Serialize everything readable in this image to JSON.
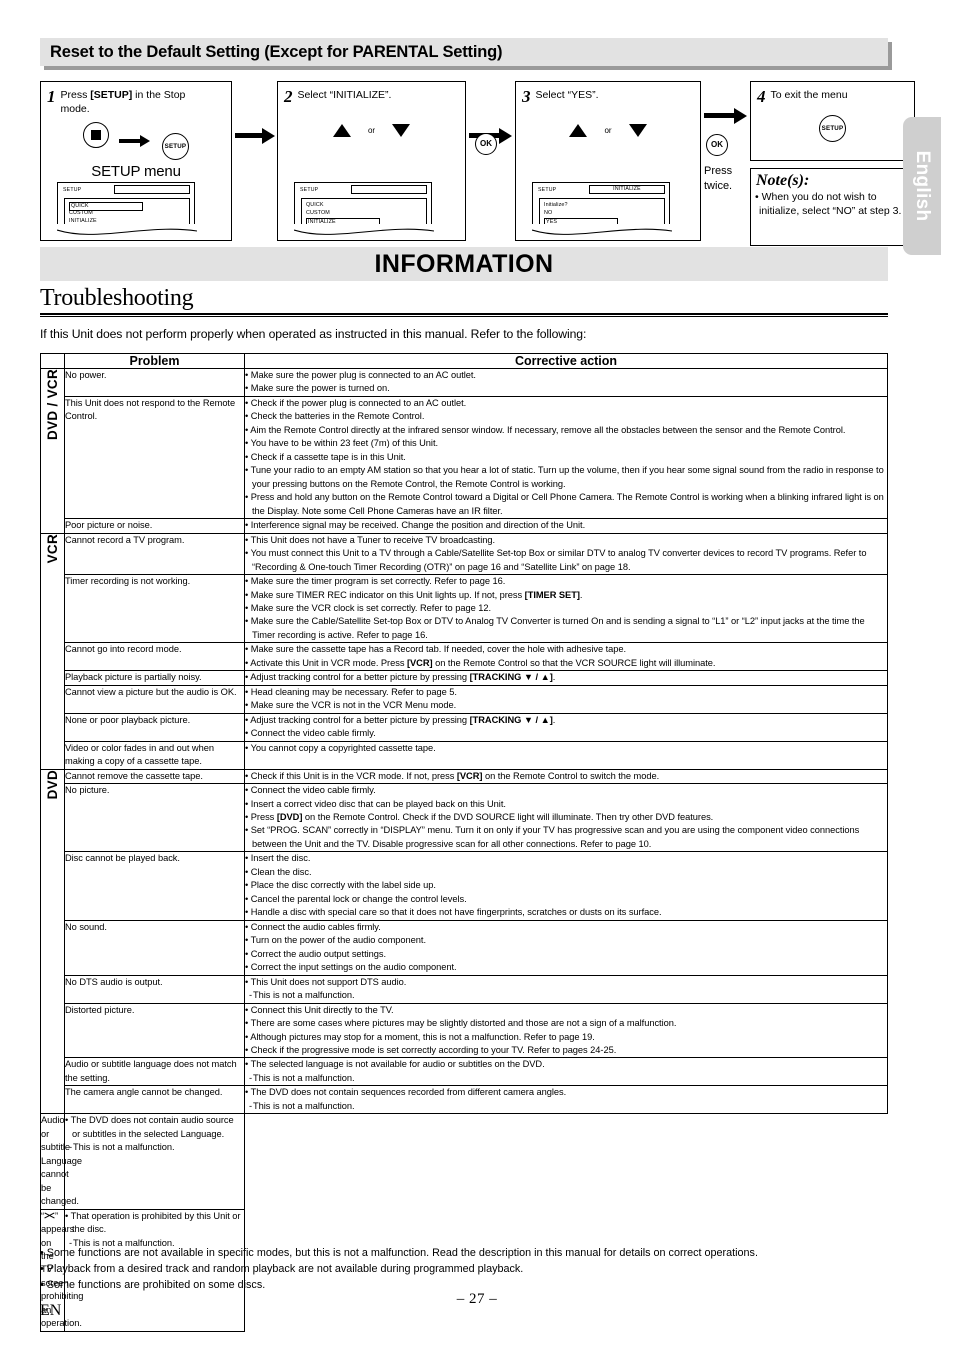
{
  "section": {
    "title": "Reset to the Default Setting (Except for PARENTAL Setting)"
  },
  "steps": [
    {
      "num": "1",
      "text_prefix": "Press ",
      "text_bold": "[SETUP]",
      "text_suffix": " in the Stop mode.",
      "icons": [
        "stop-button",
        "arrow-right",
        "setup-button"
      ],
      "caption": "SETUP menu",
      "osd": {
        "header": "SETUP",
        "header_box": "",
        "items": [
          "QUICK",
          "CUSTOM",
          "INITIALIZE"
        ],
        "selected": "QUICK"
      }
    },
    {
      "num": "2",
      "text": "Select “INITIALIZE”.",
      "or_label": "or",
      "osd": {
        "header": "SETUP",
        "header_box": "",
        "items": [
          "QUICK",
          "CUSTOM",
          "INITIALIZE"
        ],
        "selected": "INITIALIZE"
      }
    },
    {
      "num": "3",
      "text": "Select “YES”.",
      "or_label": "or",
      "osd": {
        "header": "SETUP",
        "header_box": "INITIALIZE",
        "items": [
          "Initialize?",
          "NO",
          "YES"
        ],
        "selected": "YES"
      }
    },
    {
      "num": "4",
      "text": "To exit the menu",
      "icons": [
        "setup-button"
      ]
    }
  ],
  "ok_button_label": "OK",
  "press_twice": "Press twice.",
  "notes": {
    "title": "Note(s):",
    "items": [
      "When you do not wish to initialize, select “NO” at step 3."
    ]
  },
  "language_tab": "English",
  "information_banner": "INFORMATION",
  "page_heading": "Troubleshooting",
  "intro": "If this Unit does not perform properly when operated as instructed in this manual. Refer to the following:",
  "table": {
    "headers": {
      "problem": "Problem",
      "corrective_action": "Corrective action"
    },
    "categories": [
      {
        "label": "DVD / VCR",
        "rowspan": 3
      },
      {
        "label": "VCR",
        "rowspan": 7
      },
      {
        "label": "DVD",
        "rowspan": 8
      }
    ],
    "rows": [
      {
        "problem": "No power.",
        "actions": [
          "Make sure the power plug is connected to an AC outlet.",
          "Make sure the power is turned on."
        ]
      },
      {
        "problem": "This Unit does not respond to the Remote Control.",
        "actions": [
          "Check if the power plug is connected to an AC outlet.",
          "Check the batteries in the Remote Control.",
          "Aim the Remote Control directly at the infrared sensor window. If necessary, remove all the obstacles between the sensor and the Remote Control.",
          "You have to be within 23 feet (7m) of this Unit.",
          "Check if a cassette tape is in this Unit.",
          "Tune your radio to an empty AM station so that you hear a lot of static. Turn up the volume, then if you hear some signal sound from the radio in response to your pressing buttons on the Remote Control, the Remote Control is working.",
          "Press and hold any button on the Remote Control toward a Digital or Cell Phone Camera. The Remote Control is working when a blinking infrared light is on the Display. Note some Cell Phone Cameras have an IR filter."
        ]
      },
      {
        "problem": "Poor picture or noise.",
        "actions": [
          "Interference signal may be received. Change the position and direction of the Unit."
        ]
      },
      {
        "problem": "Cannot record a TV program.",
        "actions": [
          "This Unit does not have a Tuner to receive TV broadcasting.",
          "You must connect this Unit to a TV through a Cable/Satellite Set-top Box or similar DTV to analog TV converter devices to record TV programs. Refer to “Recording & One-touch Timer Recording (OTR)” on page 16 and “Satellite Link” on page 18."
        ]
      },
      {
        "problem": "Timer recording is not working.",
        "actions": [
          "Make sure the timer program is set correctly. Refer to page 16.",
          "Make sure TIMER REC indicator on this Unit lights up. If not, press <b>[TIMER SET]</b>.",
          "Make sure the VCR clock is set correctly. Refer to page 12.",
          "Make sure the Cable/Satellite Set-top Box or DTV to Analog TV Converter is turned On and is sending a signal to “L1” or “L2” input jacks at the time the Timer recording is active. Refer to page 16."
        ]
      },
      {
        "problem": "Cannot go into record mode.",
        "actions": [
          "Make sure the cassette tape has a Record tab. If needed, cover the hole with adhesive tape.",
          "Activate this Unit in VCR mode. Press <b>[VCR]</b> on the Remote Control so that the VCR SOURCE light will illuminate."
        ]
      },
      {
        "problem": "Playback picture is partially noisy.",
        "actions": [
          "Adjust tracking control for a better picture by pressing <b>[TRACKING ▼ / ▲]</b>."
        ]
      },
      {
        "problem": "Cannot view a picture but the audio is OK.",
        "actions": [
          "Head cleaning may be necessary. Refer to page 5.",
          "Make sure the VCR is not in the VCR Menu mode."
        ]
      },
      {
        "problem": "None or poor playback picture.",
        "actions": [
          "Adjust tracking control for a better picture by pressing <b>[TRACKING ▼ / ▲]</b>.",
          "Connect the video cable firmly."
        ]
      },
      {
        "problem": "Video or color fades in and out when making a copy of a cassette tape.",
        "actions": [
          "You cannot copy a copyrighted cassette tape."
        ]
      },
      {
        "problem": "Cannot remove the cassette tape.",
        "actions": [
          "Check if this Unit is in the VCR mode. If not, press <b>[VCR]</b> on the Remote Control to switch the mode."
        ]
      },
      {
        "problem": "No picture.",
        "actions": [
          "Connect the video cable firmly.",
          "Insert a correct video disc that can be played back on this Unit.",
          "Press <b>[DVD]</b> on the Remote Control. Check if the DVD SOURCE light will illuminate. Then try other DVD features.",
          "Set “PROG. SCAN” correctly in “DISPLAY” menu. Turn it on only if your TV has progressive scan and you are using the component video connections between the Unit and the TV. Disable progressive scan for all other connections. Refer to page 10."
        ]
      },
      {
        "problem": "Disc cannot be played back.",
        "actions": [
          "Insert the disc.",
          "Clean the disc.",
          "Place the disc correctly with the label side up.",
          "Cancel the parental lock or change the control levels.",
          "Handle a disc with special care so that it does not have fingerprints, scratches or dusts on its surface."
        ]
      },
      {
        "problem": "No sound.",
        "actions": [
          "Connect the audio cables firmly.",
          "Turn on the power of the audio component.",
          "Correct the audio output settings.",
          "Correct the input settings on the audio component."
        ]
      },
      {
        "problem": "No DTS audio is output.",
        "actions": [
          "This Unit does not support DTS audio."
        ],
        "sub": [
          "This is not a malfunction."
        ]
      },
      {
        "problem": "Distorted picture.",
        "actions": [
          "Connect this Unit directly to the TV.",
          "There are some cases where pictures may be slightly distorted and those are not a sign of a malfunction.",
          "Although pictures may stop for a moment, this is not a malfunction. Refer to page 19.",
          "Check if the progressive mode is set correctly according to your TV. Refer to pages 24-25."
        ]
      },
      {
        "problem": "Audio or subtitle language does not match the setting.",
        "actions": [
          "The selected language is not available for audio or subtitles on the DVD."
        ],
        "sub": [
          "This is not a malfunction."
        ]
      },
      {
        "problem": "The camera angle cannot be changed.",
        "actions": [
          "The DVD does not contain sequences recorded from different camera angles."
        ],
        "sub": [
          "This is not a malfunction."
        ]
      },
      {
        "problem": "Audio or subtitle Language cannot be changed.",
        "actions": [
          "The DVD does not contain audio source or subtitles in the selected Language."
        ],
        "sub": [
          "This is not a malfunction."
        ]
      },
      {
        "problem": "“✕” appears on the TV screen, prohibiting an operation.",
        "problem_has_x_glyph": true,
        "problem_prefix": "“",
        "problem_suffix": "” appears on the TV screen, prohibiting an operation.",
        "actions": [
          "That operation is prohibited by this Unit or the disc."
        ],
        "sub": [
          "This is not a malfunction."
        ]
      }
    ]
  },
  "footer_notes": [
    "Some functions are not available in specific modes, but this is not a malfunction. Read the description in this manual for details on correct operations.",
    "Playback from a desired track and random playback are not available during programmed playback.",
    "Some functions are prohibited on some discs."
  ],
  "page_number": "– 27 –",
  "edition_code": "EN"
}
